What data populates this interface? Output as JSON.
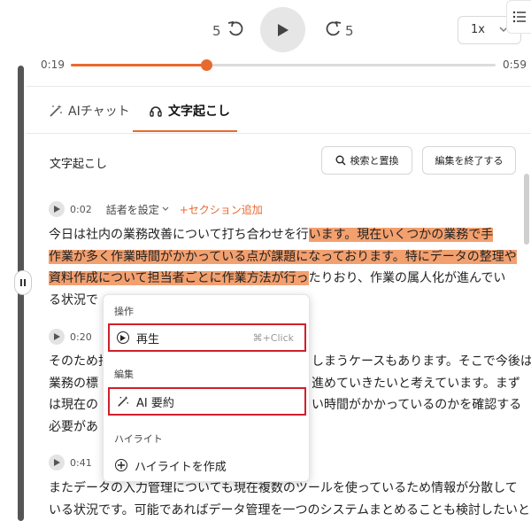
{
  "player": {
    "skip_back": "5",
    "skip_forward": "5",
    "speed": "1x",
    "time_current": "0:19",
    "time_total": "0:59",
    "progress": 0.32
  },
  "tabs": {
    "ai_chat": "AIチャット",
    "transcription": "文字起こし"
  },
  "transcript": {
    "title": "文字起こし",
    "search_replace": "検索と置換",
    "finish_editing": "編集を終了する",
    "speaker_label": "話者を設定",
    "add_section": "+セクション追加",
    "segments": [
      {
        "time": "0:02",
        "lines": [
          {
            "plain": "今日は社内の業務改善について打ち合わせを行",
            "hl": "います。現在いくつかの業務で手"
          },
          {
            "plain": "",
            "hl": "作業が多く作業時間がかかっている点が課題になっております。特にデータの整理や"
          },
          {
            "plain_after": "たりおり、作業の属人化が進んでい",
            "hl": "資料作成について担当者ごとに作業方法が行っ"
          },
          {
            "plain": "る状況で"
          }
        ]
      },
      {
        "time": "0:20",
        "lines": [
          "そのため担",
          "業務の標",
          "は現在の",
          "必要があ"
        ],
        "lines_right": [
          "しまうケースもあります。そこで今後は",
          "進めていきたいと考えています。まず",
          "い時間がかかっているのかを確認する",
          ""
        ]
      },
      {
        "time": "0:41",
        "lines": [
          "またデータの入力管理についても現在複数のツールを使っているため情報が分散して",
          "いる状況です。可能であればデータ管理を一つのシステムまとめることも検討したいと"
        ]
      }
    ]
  },
  "context_menu": {
    "group_operation": "操作",
    "play": "再生",
    "play_shortcut": "⌘+Click",
    "group_edit": "編集",
    "ai_summary": "AI 要約",
    "group_highlight": "ハイライト",
    "create_highlight": "ハイライトを作成"
  },
  "colors": {
    "accent": "#e8692e",
    "highlight": "#f3a06f",
    "focus_box": "#d0202a"
  }
}
